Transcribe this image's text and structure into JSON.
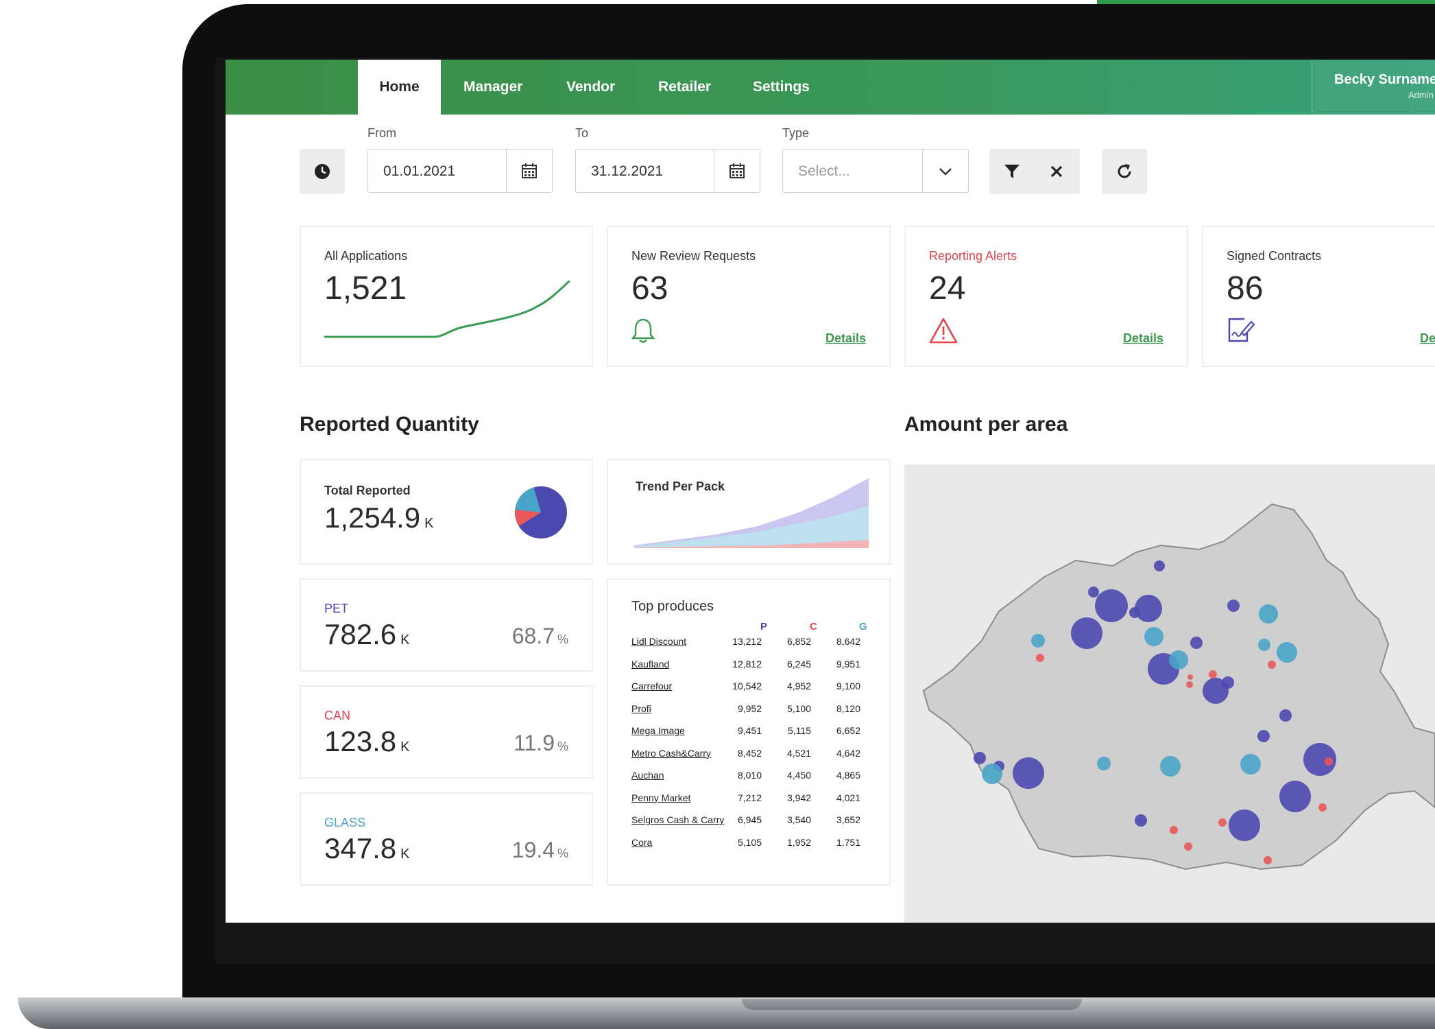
{
  "nav": {
    "tabs": [
      "Home",
      "Manager",
      "Vendor",
      "Retailer",
      "Settings"
    ],
    "user_name": "Becky Surname",
    "user_role": "Admin"
  },
  "filters": {
    "from_label": "From",
    "from_value": "01.01.2021",
    "to_label": "To",
    "to_value": "31.12.2021",
    "type_label": "Type",
    "type_placeholder": "Select..."
  },
  "kpis": [
    {
      "label": "All Applications",
      "value": "1,521"
    },
    {
      "label": "New Review Requests",
      "value": "63",
      "link": "Details"
    },
    {
      "label": "Reporting Alerts",
      "value": "24",
      "link": "Details"
    },
    {
      "label": "Signed Contracts",
      "value": "86",
      "link": "De"
    }
  ],
  "sections": {
    "reported_quantity": "Reported Quantity",
    "amount_per_area": "Amount per area"
  },
  "total_reported": {
    "label": "Total Reported",
    "value": "1,254.9",
    "unit": "K"
  },
  "trend": {
    "label": "Trend Per Pack"
  },
  "materials": [
    {
      "label": "PET",
      "value": "782.6",
      "unit": "K",
      "pct": "68.7",
      "pct_unit": "%"
    },
    {
      "label": "CAN",
      "value": "123.8",
      "unit": "K",
      "pct": "11.9",
      "pct_unit": "%"
    },
    {
      "label": "GLASS",
      "value": "347.8",
      "unit": "K",
      "pct": "19.4",
      "pct_unit": "%"
    }
  ],
  "top_produces": {
    "title": "Top produces",
    "headers": [
      "P",
      "C",
      "G"
    ],
    "rows": [
      {
        "name": "Lidl Discount",
        "p": "13,212",
        "c": "6,852",
        "g": "8,642"
      },
      {
        "name": "Kaufland",
        "p": "12,812",
        "c": "6,245",
        "g": "9,951"
      },
      {
        "name": "Carrefour",
        "p": "10,542",
        "c": "4,952",
        "g": "9,100"
      },
      {
        "name": "Profi",
        "p": "9,952",
        "c": "5,100",
        "g": "8,120"
      },
      {
        "name": "Mega Image",
        "p": "9,451",
        "c": "5,115",
        "g": "6,652"
      },
      {
        "name": "Metro Cash&Carry",
        "p": "8,452",
        "c": "4,521",
        "g": "4,642"
      },
      {
        "name": "Auchan",
        "p": "8,010",
        "c": "4,450",
        "g": "4,865"
      },
      {
        "name": "Penny Market",
        "p": "7,212",
        "c": "3,942",
        "g": "4,021"
      },
      {
        "name": "Selgros Cash & Carry",
        "p": "6,945",
        "c": "3,540",
        "g": "3,652"
      },
      {
        "name": "Cora",
        "p": "5,105",
        "c": "1,952",
        "g": "1,751"
      }
    ]
  },
  "colors": {
    "brand_green": "#3b8e47",
    "pet_purple": "#4b48b0",
    "can_red": "#e8575a",
    "glass_blue": "#4aa3c8",
    "alert_red": "#e0464b"
  },
  "icons": [
    "clock-icon",
    "calendar-icon",
    "chevron-down-icon",
    "filter-icon",
    "close-icon",
    "refresh-icon",
    "bell-icon",
    "warning-icon",
    "contract-sign-icon"
  ]
}
